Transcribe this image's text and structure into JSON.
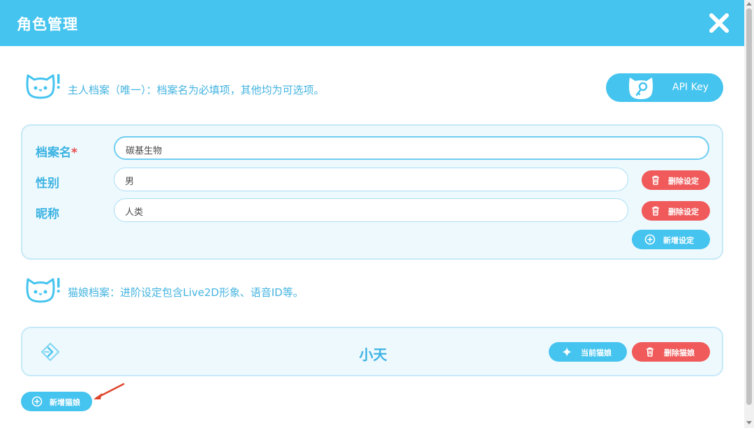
{
  "window": {
    "title": "角色管理"
  },
  "owner_notice": "主人档案（唯一）：档案名为必填项，其他均为可选项。",
  "api_button": {
    "label": "API Key"
  },
  "owner_fields": [
    {
      "label": "档案名",
      "required_mark": "*",
      "value": "碳基生物"
    },
    {
      "label": "性别",
      "value": "男",
      "delete_label": "删除设定"
    },
    {
      "label": "昵称",
      "value": "人类",
      "delete_label": "删除设定"
    }
  ],
  "add_setting_label": "新增设定",
  "catgirl_notice": "猫娘档案：进阶设定包含Live2D形象、语音ID等。",
  "catgirl_card": {
    "name": "小天",
    "current_label": "当前猫娘",
    "delete_label": "删除猫娘"
  },
  "add_catgirl_label": "新增猫娘",
  "colors": {
    "accent": "#45c4ef",
    "danger": "#f05a5a",
    "panel_bg": "#eef9fe",
    "annotation": "#e0442c"
  },
  "icons": [
    "close-icon",
    "cat-logo-icon",
    "key-icon",
    "trash-icon",
    "plus-circle-icon",
    "sparkle-icon",
    "diamond-arrow-icon"
  ]
}
